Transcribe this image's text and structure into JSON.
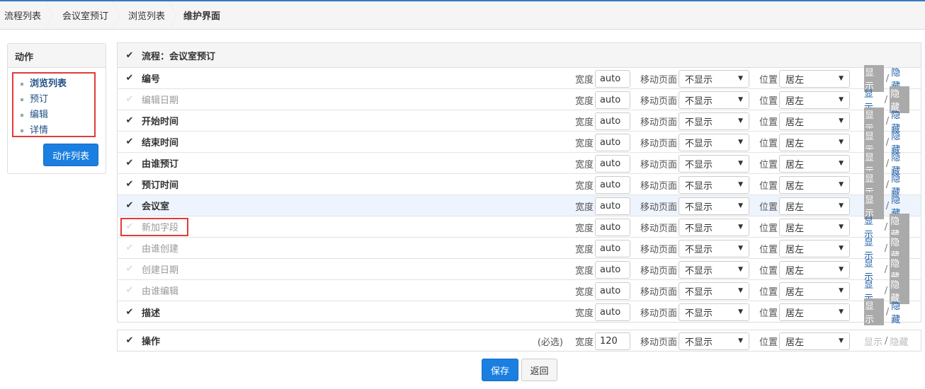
{
  "breadcrumb": [
    "流程列表",
    "会议室预订",
    "浏览列表",
    "维护界面"
  ],
  "actions": {
    "title": "动作",
    "items": [
      {
        "label": "浏览列表",
        "active": true
      },
      {
        "label": "预订",
        "active": false
      },
      {
        "label": "编辑",
        "active": false
      },
      {
        "label": "详情",
        "active": false
      }
    ],
    "button": "动作列表"
  },
  "flow": {
    "heading": "流程：会议室预订"
  },
  "labels": {
    "width": "宽度",
    "mobile": "移动页面",
    "position": "位置",
    "show": "显示",
    "hide": "隐藏",
    "sep": "/",
    "required": "(必选)"
  },
  "fields": [
    {
      "name": "编号",
      "checked": true,
      "width": "auto",
      "mobile": "不显示",
      "position": "居左",
      "state": "hidden"
    },
    {
      "name": "编辑日期",
      "checked": false,
      "width": "auto",
      "mobile": "不显示",
      "position": "居左",
      "state": "shown"
    },
    {
      "name": "开始时间",
      "checked": true,
      "width": "auto",
      "mobile": "不显示",
      "position": "居左",
      "state": "hidden"
    },
    {
      "name": "结束时间",
      "checked": true,
      "width": "auto",
      "mobile": "不显示",
      "position": "居左",
      "state": "hidden"
    },
    {
      "name": "由谁预订",
      "checked": true,
      "width": "auto",
      "mobile": "不显示",
      "position": "居左",
      "state": "hidden"
    },
    {
      "name": "预订时间",
      "checked": true,
      "width": "auto",
      "mobile": "不显示",
      "position": "居左",
      "state": "hidden"
    },
    {
      "name": "会议室",
      "checked": true,
      "width": "auto",
      "mobile": "不显示",
      "position": "居左",
      "state": "hidden",
      "selected": true
    },
    {
      "name": "新加字段",
      "checked": false,
      "width": "auto",
      "mobile": "不显示",
      "position": "居左",
      "state": "shown",
      "highlight": true
    },
    {
      "name": "由谁创建",
      "checked": false,
      "width": "auto",
      "mobile": "不显示",
      "position": "居左",
      "state": "shown"
    },
    {
      "name": "创建日期",
      "checked": false,
      "width": "auto",
      "mobile": "不显示",
      "position": "居左",
      "state": "shown"
    },
    {
      "name": "由谁编辑",
      "checked": false,
      "width": "auto",
      "mobile": "不显示",
      "position": "居左",
      "state": "shown"
    },
    {
      "name": "描述",
      "checked": true,
      "width": "auto",
      "mobile": "不显示",
      "position": "居左",
      "state": "hidden"
    }
  ],
  "operation": {
    "name": "操作",
    "width": "120",
    "mobile": "不显示",
    "position": "居左"
  },
  "buttons": {
    "save": "保存",
    "back": "返回"
  },
  "colors": {
    "accent": "#1a7fe0",
    "highlight_box": "#e03b3b",
    "selected_row": "#eef4fd"
  }
}
